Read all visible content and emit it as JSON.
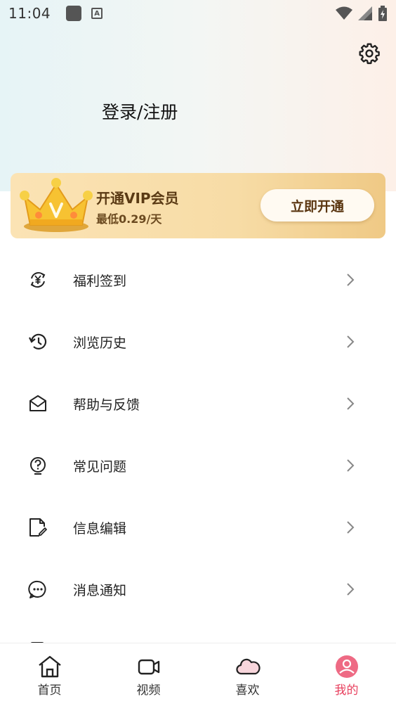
{
  "status_bar": {
    "time": "11:04"
  },
  "header": {
    "login_text": "登录/注册"
  },
  "vip": {
    "title": "开通VIP会员",
    "subtitle": "最低0.29/天",
    "button_label": "立即开通"
  },
  "menu": {
    "items": [
      {
        "label": "福利签到",
        "icon": "yen-cycle-icon"
      },
      {
        "label": "浏览历史",
        "icon": "history-icon"
      },
      {
        "label": "帮助与反馈",
        "icon": "mail-icon"
      },
      {
        "label": "常见问题",
        "icon": "question-icon"
      },
      {
        "label": "信息编辑",
        "icon": "edit-file-icon"
      },
      {
        "label": "消息通知",
        "icon": "chat-bubble-icon"
      }
    ]
  },
  "tabbar": {
    "tabs": [
      {
        "label": "首页",
        "icon": "home-icon"
      },
      {
        "label": "视频",
        "icon": "video-icon"
      },
      {
        "label": "喜欢",
        "icon": "cloud-icon"
      },
      {
        "label": "我的",
        "icon": "profile-icon",
        "active": true
      }
    ],
    "active_color": "#e8415f"
  },
  "colors": {
    "vip_gold": "#f7dca6",
    "vip_text": "#5a3a14"
  }
}
